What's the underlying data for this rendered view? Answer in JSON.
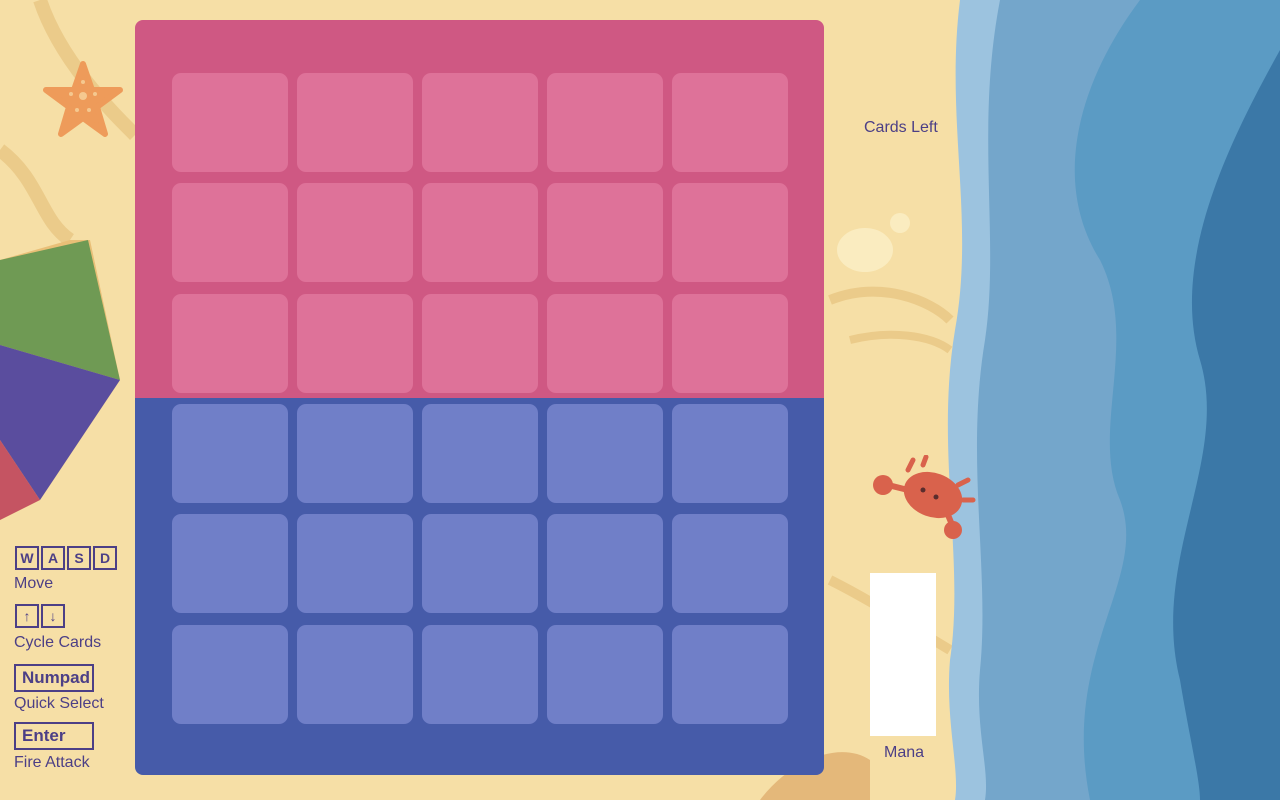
{
  "hud": {
    "cards_left_label": "Cards Left",
    "mana_label": "Mana"
  },
  "controls": [
    {
      "keys": [
        "W",
        "A",
        "S",
        "D"
      ],
      "label": "Move"
    },
    {
      "keys": [
        "↑",
        "↓"
      ],
      "label": "Cycle Cards"
    },
    {
      "keys": [
        "Numpad"
      ],
      "label": "Quick Select"
    },
    {
      "keys": [
        "Enter"
      ],
      "label": "Fire Attack"
    }
  ],
  "board": {
    "columns": 5,
    "enemy_rows": 3,
    "player_rows": 3,
    "colors": {
      "enemy_side": "#cf5883",
      "enemy_tile": "#de7299",
      "player_side": "#465ba9",
      "player_tile": "#707fc8"
    }
  },
  "colors": {
    "sand": "#f6dfa6",
    "ocean_light": "#9cc3df",
    "ocean_mid": "#5b9bc4",
    "ocean_dark": "#3b78a7",
    "text": "#4c3f86"
  }
}
